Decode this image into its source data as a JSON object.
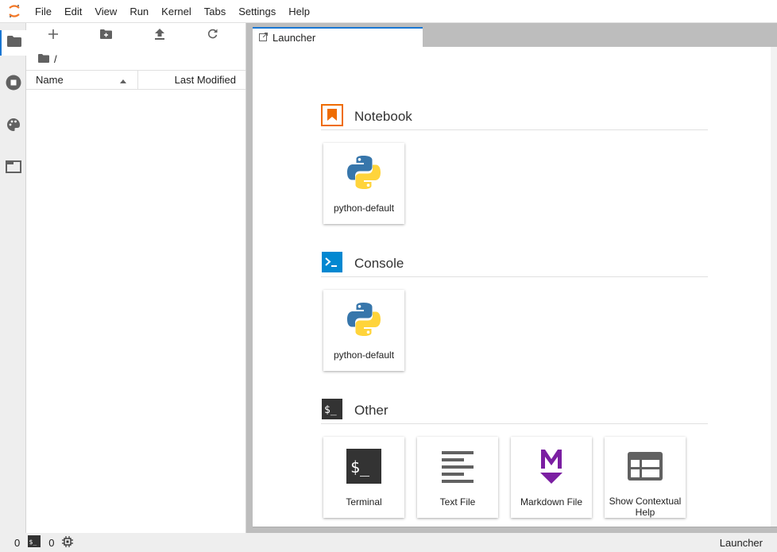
{
  "menubar": {
    "items": [
      "File",
      "Edit",
      "View",
      "Run",
      "Kernel",
      "Tabs",
      "Settings",
      "Help"
    ]
  },
  "filebrowser": {
    "breadcrumb": "/",
    "columns": {
      "name": "Name",
      "modified": "Last Modified"
    }
  },
  "dock": {
    "tab_label": "Launcher"
  },
  "launcher": {
    "sections": [
      {
        "title": "Notebook",
        "icon": "notebook-icon",
        "cards": [
          {
            "label": "python-default",
            "icon": "python-icon"
          }
        ]
      },
      {
        "title": "Console",
        "icon": "console-icon",
        "cards": [
          {
            "label": "python-default",
            "icon": "python-icon"
          }
        ]
      },
      {
        "title": "Other",
        "icon": "terminal-icon",
        "cards": [
          {
            "label": "Terminal",
            "icon": "terminal-icon"
          },
          {
            "label": "Text File",
            "icon": "text-file-icon"
          },
          {
            "label": "Markdown File",
            "icon": "markdown-icon"
          },
          {
            "label": "Show Contextual Help",
            "icon": "contextual-help-icon"
          }
        ]
      }
    ]
  },
  "statusbar": {
    "kernels_count": "0",
    "terminals_count": "0",
    "active": "Launcher"
  },
  "colors": {
    "accent": "#1976d2",
    "notebook": "#ef6c00",
    "console": "#0288d1",
    "markdown": "#7b1fa2",
    "python_blue": "#3776ab",
    "python_yellow": "#ffd43b"
  }
}
